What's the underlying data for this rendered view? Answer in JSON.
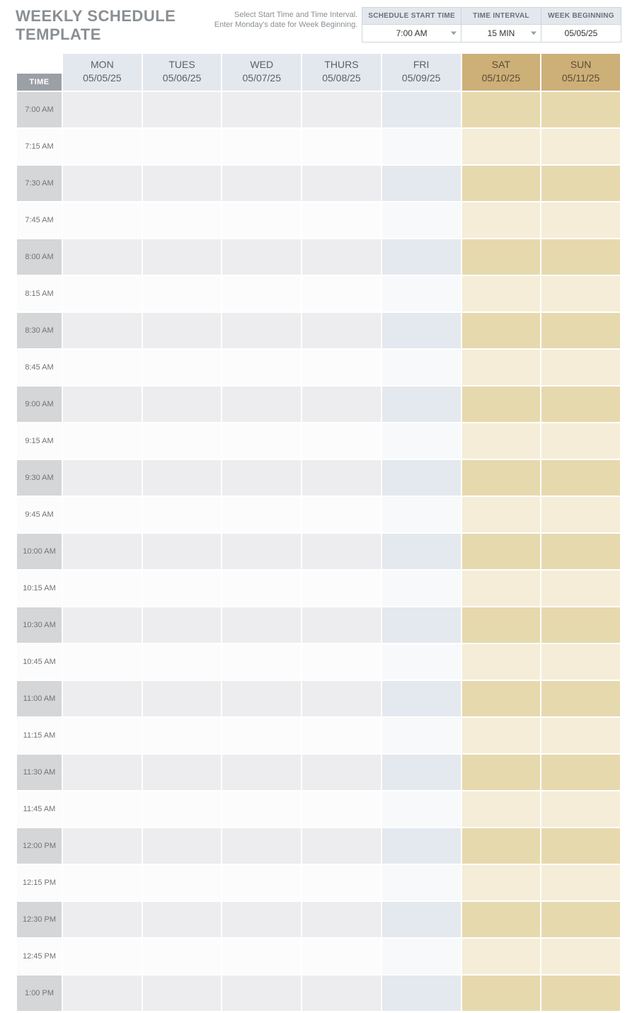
{
  "title": "WEEKLY SCHEDULE TEMPLATE",
  "instructions_l1": "Select Start Time and Time Interval.",
  "instructions_l2": "Enter Monday's date for Week Beginning.",
  "controls": {
    "start_label": "SCHEDULE START TIME",
    "start_value": "7:00 AM",
    "interval_label": "TIME INTERVAL",
    "interval_value": "15 MIN",
    "week_label": "WEEK BEGINNING",
    "week_value": "05/05/25"
  },
  "time_header": "TIME",
  "days": [
    {
      "name": "MON",
      "date": "05/05/25",
      "cls": ""
    },
    {
      "name": "TUES",
      "date": "05/06/25",
      "cls": ""
    },
    {
      "name": "WED",
      "date": "05/07/25",
      "cls": ""
    },
    {
      "name": "THURS",
      "date": "05/08/25",
      "cls": ""
    },
    {
      "name": "FRI",
      "date": "05/09/25",
      "cls": "fri"
    },
    {
      "name": "SAT",
      "date": "05/10/25",
      "cls": "weekend"
    },
    {
      "name": "SUN",
      "date": "05/11/25",
      "cls": "weekend"
    }
  ],
  "times": [
    "7:00 AM",
    "7:15 AM",
    "7:30 AM",
    "7:45 AM",
    "8:00 AM",
    "8:15 AM",
    "8:30 AM",
    "8:45 AM",
    "9:00 AM",
    "9:15 AM",
    "9:30 AM",
    "9:45 AM",
    "10:00 AM",
    "10:15 AM",
    "10:30 AM",
    "10:45 AM",
    "11:00 AM",
    "11:15 AM",
    "11:30 AM",
    "11:45 AM",
    "12:00 PM",
    "12:15 PM",
    "12:30 PM",
    "12:45 PM",
    "1:00 PM"
  ]
}
